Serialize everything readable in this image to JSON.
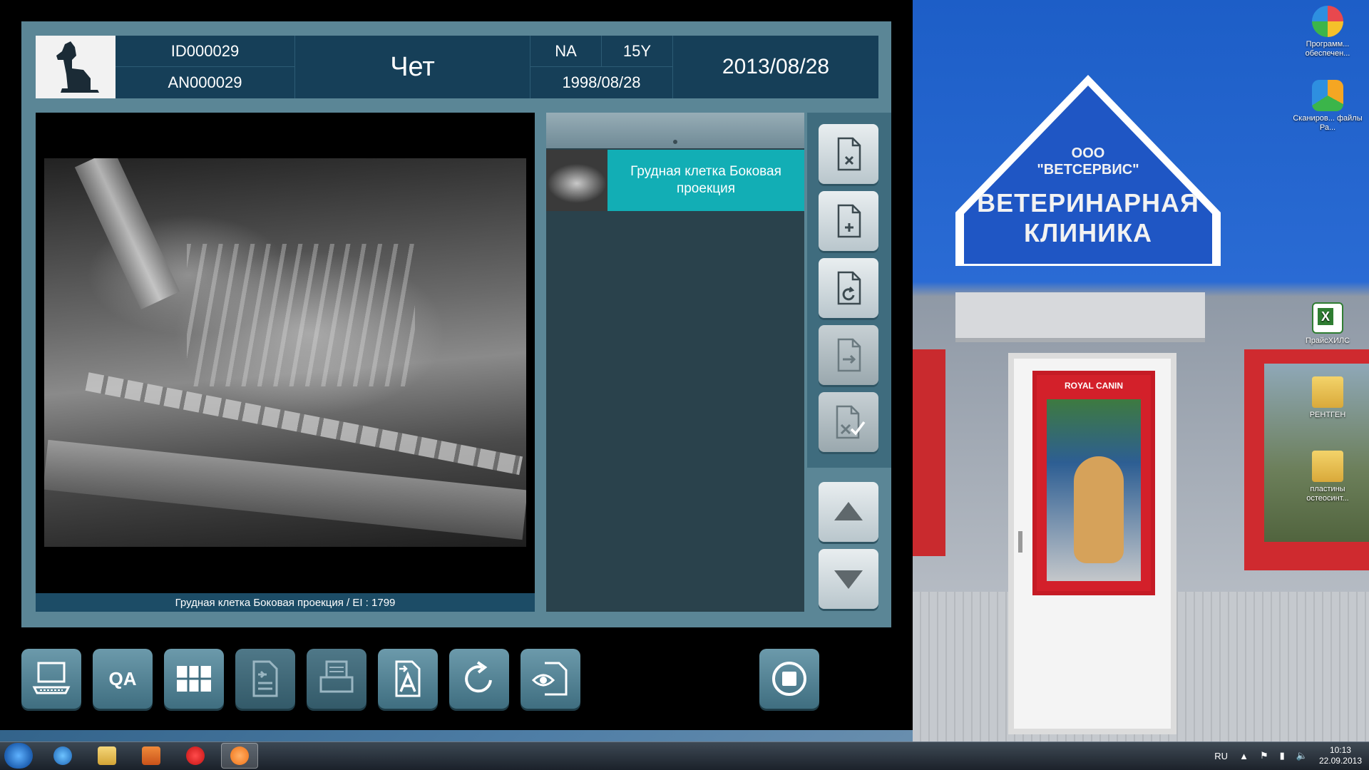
{
  "desktop": {
    "sign": {
      "line1": "ООО",
      "line2": "\"ВЕТСЕРВИС\"",
      "line3": "ВЕТЕРИНАРНАЯ",
      "line4": "КЛИНИКА"
    },
    "poster_brand": "ROYAL CANIN",
    "icons": [
      {
        "name": "program-icon",
        "label": "Программ... обеспечен..."
      },
      {
        "name": "scan-icon",
        "label": "Сканиров... файлы Ра..."
      },
      {
        "name": "excel-icon",
        "label": "ПрайсХИЛС"
      },
      {
        "name": "folder-icon",
        "label": "РЕНТГЕН"
      },
      {
        "name": "folder-shortcut-icon",
        "label": "пластины остеосинт..."
      }
    ]
  },
  "patient": {
    "id": "ID000029",
    "accession": "AN000029",
    "name": "Чет",
    "sex": "NA",
    "age": "15Y",
    "birth_date": "1998/08/28",
    "study_date": "2013/08/28"
  },
  "viewer": {
    "caption": "Грудная клетка Боковая проекция /  EI : 1799"
  },
  "image_list": {
    "items": [
      {
        "label": "Грудная клетка Боковая проекция"
      }
    ]
  },
  "side_buttons": [
    {
      "name": "delete-image-button",
      "icon": "file-x-icon"
    },
    {
      "name": "add-image-button",
      "icon": "file-plus-icon"
    },
    {
      "name": "retake-image-button",
      "icon": "file-refresh-icon"
    },
    {
      "name": "transfer-image-button",
      "icon": "file-arrow-icon"
    },
    {
      "name": "accept-image-button",
      "icon": "file-check-icon"
    },
    {
      "name": "scroll-up-button",
      "icon": "triangle-up-icon"
    },
    {
      "name": "scroll-down-button",
      "icon": "triangle-down-icon"
    }
  ],
  "toolbar": {
    "qa_label": "QA",
    "buttons": [
      {
        "name": "acquisition-button",
        "icon": "computer-icon"
      },
      {
        "name": "qa-button",
        "icon": "qa-text"
      },
      {
        "name": "layout-grid-button",
        "icon": "grid-icon"
      },
      {
        "name": "report-button",
        "icon": "document-icon"
      },
      {
        "name": "print-button",
        "icon": "printer-icon"
      },
      {
        "name": "annotate-button",
        "icon": "text-a-icon"
      },
      {
        "name": "rotate-button",
        "icon": "rotate-icon"
      },
      {
        "name": "view-button",
        "icon": "eye-document-icon"
      },
      {
        "name": "stop-button",
        "icon": "stop-icon"
      }
    ]
  },
  "taskbar": {
    "language": "RU",
    "time": "10:13",
    "date": "22.09.2013"
  },
  "colors": {
    "patient_bar": "#163f58",
    "panel": "#5b8696",
    "list_selected": "#12aeb5",
    "list_bg": "#2a424c"
  }
}
